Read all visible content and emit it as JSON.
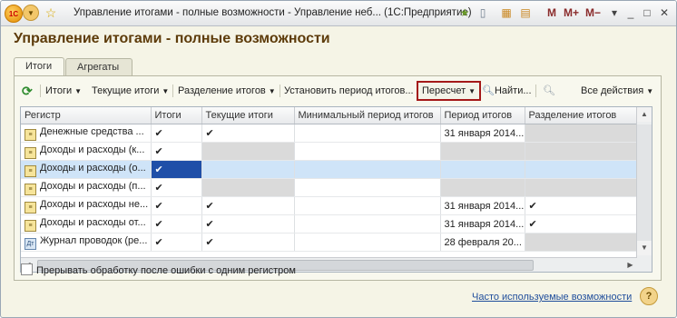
{
  "window": {
    "title": "Управление итогами - полные возможности - Управление неб... (1С:Предприятие)",
    "logo_text": "1С",
    "m_buttons": [
      "M",
      "M+",
      "M−"
    ]
  },
  "form": {
    "title": "Управление итогами - полные возможности"
  },
  "tabs": [
    {
      "label": "Итоги"
    },
    {
      "label": "Агрегаты"
    }
  ],
  "toolbar": {
    "refresh_icon": "refresh-icon",
    "totals": "Итоги",
    "current_totals": "Текущие итоги",
    "split_totals": "Разделение итогов",
    "set_period": "Установить период итогов...",
    "recalc": "Пересчет",
    "find": "Найти...",
    "all_actions": "Все действия"
  },
  "grid": {
    "columns": [
      "Регистр",
      "Итоги",
      "Текущие итоги",
      "Минимальный период итогов",
      "Период итогов",
      "Разделение итогов"
    ],
    "rows": [
      {
        "name": "Денежные средства ...",
        "icon": "register-icon",
        "totals": "✔",
        "current": "✔",
        "min_period": "",
        "period": "31 января 2014...",
        "split": "",
        "grey": [
          "split"
        ]
      },
      {
        "name": "Доходы и расходы (к...",
        "icon": "register-icon",
        "totals": "✔",
        "current": "",
        "min_period": "",
        "period": "",
        "split": "",
        "grey": [
          "current",
          "period",
          "split"
        ]
      },
      {
        "name": "Доходы и расходы (о...",
        "icon": "register-icon",
        "totals": "✔",
        "current": "",
        "min_period": "",
        "period": "",
        "split": "",
        "grey": [],
        "selected": true
      },
      {
        "name": "Доходы и расходы (п...",
        "icon": "register-icon",
        "totals": "✔",
        "current": "",
        "min_period": "",
        "period": "",
        "split": "",
        "grey": [
          "current",
          "period",
          "split"
        ]
      },
      {
        "name": "Доходы и расходы не...",
        "icon": "register-icon",
        "totals": "✔",
        "current": "✔",
        "min_period": "",
        "period": "31 января 2014...",
        "split": "✔",
        "grey": []
      },
      {
        "name": "Доходы и расходы от...",
        "icon": "register-icon",
        "totals": "✔",
        "current": "✔",
        "min_period": "",
        "period": "31 января 2014...",
        "split": "✔",
        "grey": []
      },
      {
        "name": "Журнал проводок (ре...",
        "icon": "accounting-register-icon",
        "totals": "✔",
        "current": "✔",
        "min_period": "",
        "period": "28 февраля 20...",
        "split": "",
        "grey": [
          "split"
        ]
      }
    ]
  },
  "options": {
    "stop_on_error": "Прерывать обработку после ошибки с одним регистром",
    "stop_on_error_checked": false
  },
  "footer": {
    "link": "Часто используемые возможности",
    "help": "?"
  }
}
